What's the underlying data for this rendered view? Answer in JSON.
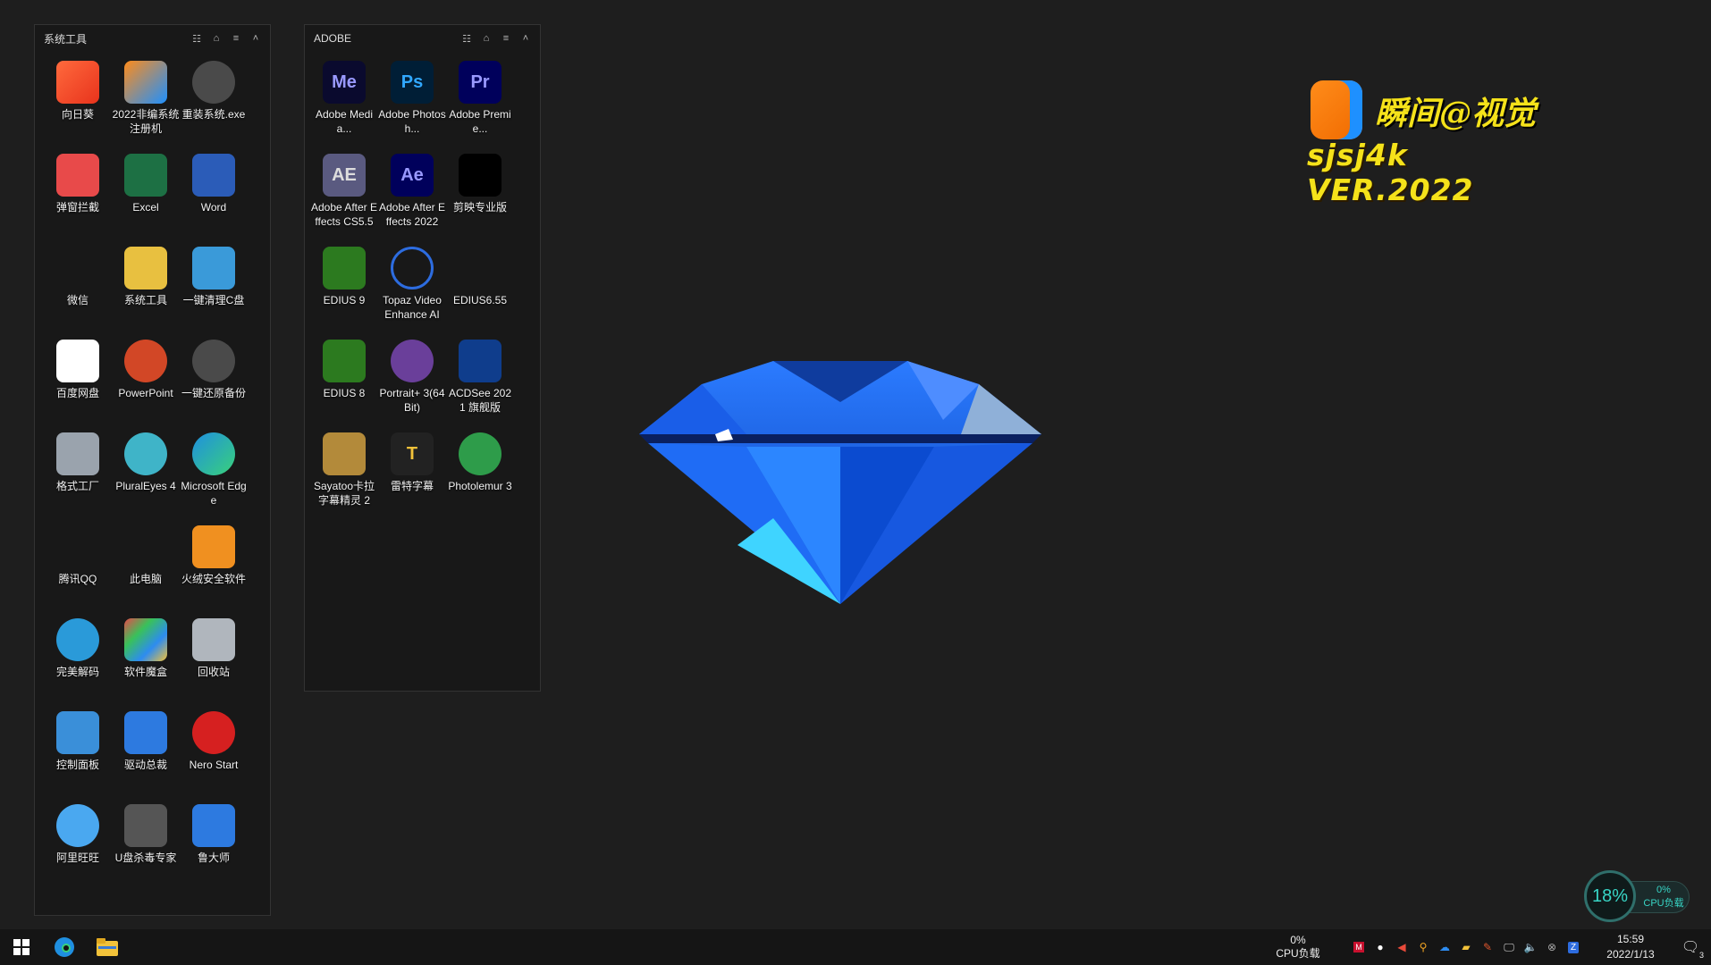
{
  "fences": {
    "system": {
      "title": "系统工具",
      "items": [
        {
          "label": "向日葵",
          "icon": "sunlogin-icon"
        },
        {
          "label": "2022非编系统注册机",
          "icon": "sjsj4k-icon"
        },
        {
          "label": "重装系统.exe",
          "icon": "reinstall-icon"
        },
        {
          "label": "弹窗拦截",
          "icon": "popup-block-icon"
        },
        {
          "label": "Excel",
          "icon": "excel-icon"
        },
        {
          "label": "Word",
          "icon": "word-icon"
        },
        {
          "label": "微信",
          "icon": "wechat-icon"
        },
        {
          "label": "系统工具",
          "icon": "system-tools-icon"
        },
        {
          "label": "一键清理C盘",
          "icon": "clean-c-icon"
        },
        {
          "label": "百度网盘",
          "icon": "baidu-pan-icon"
        },
        {
          "label": "PowerPoint",
          "icon": "powerpoint-icon"
        },
        {
          "label": "一键还原备份",
          "icon": "restore-backup-icon"
        },
        {
          "label": "格式工厂",
          "icon": "format-factory-icon"
        },
        {
          "label": "PluralEyes 4",
          "icon": "pluraleyes-icon"
        },
        {
          "label": "Microsoft Edge",
          "icon": "edge-icon"
        },
        {
          "label": "腾讯QQ",
          "icon": "qq-icon"
        },
        {
          "label": "此电脑",
          "icon": "this-pc-icon"
        },
        {
          "label": "火绒安全软件",
          "icon": "huorong-icon"
        },
        {
          "label": "完美解码",
          "icon": "potplayer-icon"
        },
        {
          "label": "软件魔盒",
          "icon": "software-box-icon"
        },
        {
          "label": "回收站",
          "icon": "recycle-bin-icon"
        },
        {
          "label": "控制面板",
          "icon": "control-panel-icon"
        },
        {
          "label": "驱动总裁",
          "icon": "driver-icon"
        },
        {
          "label": "Nero Start",
          "icon": "nero-icon"
        },
        {
          "label": "阿里旺旺",
          "icon": "aliwangwang-icon"
        },
        {
          "label": "U盘杀毒专家",
          "icon": "usb-antivirus-icon"
        },
        {
          "label": "鲁大师",
          "icon": "ludashi-icon"
        }
      ]
    },
    "adobe": {
      "title": "ADOBE",
      "items": [
        {
          "label": "Adobe Media...",
          "icon": "media-encoder-icon",
          "glyph": "Me"
        },
        {
          "label": "Adobe Photosh...",
          "icon": "photoshop-icon",
          "glyph": "Ps"
        },
        {
          "label": "Adobe Premie...",
          "icon": "premiere-icon",
          "glyph": "Pr"
        },
        {
          "label": "Adobe After Effects CS5.5",
          "icon": "after-effects-cs55-icon",
          "glyph": "AE"
        },
        {
          "label": "Adobe After Effects 2022",
          "icon": "after-effects-2022-icon",
          "glyph": "Ae"
        },
        {
          "label": "剪映专业版",
          "icon": "jianying-icon",
          "glyph": ""
        },
        {
          "label": "EDIUS 9",
          "icon": "edius9-icon",
          "glyph": ""
        },
        {
          "label": "Topaz Video Enhance AI",
          "icon": "topaz-icon",
          "glyph": ""
        },
        {
          "label": "EDIUS6.55",
          "icon": "edius655-icon",
          "glyph": ""
        },
        {
          "label": "EDIUS 8",
          "icon": "edius8-icon",
          "glyph": ""
        },
        {
          "label": "Portrait+ 3(64 Bit)",
          "icon": "portrait-plus-icon",
          "glyph": ""
        },
        {
          "label": "ACDSee 2021 旗舰版",
          "icon": "acdsee-icon",
          "glyph": ""
        },
        {
          "label": "Sayatoo卡拉字幕精灵 2",
          "icon": "sayatoo-icon",
          "glyph": ""
        },
        {
          "label": "雷特字幕",
          "icon": "leite-icon",
          "glyph": "T"
        },
        {
          "label": "Photolemur 3",
          "icon": "photolemur-icon",
          "glyph": ""
        }
      ]
    }
  },
  "logo": {
    "cn": "瞬间@视觉",
    "en": "sjsj4k VER.2022"
  },
  "cpu_widget": {
    "percent": "18%",
    "load": "0%",
    "label": "CPU负载"
  },
  "taskbar": {
    "cpu_percent": "0%",
    "cpu_label": "CPU负载",
    "time": "15:59",
    "date": "2022/1/13",
    "notifications": "3"
  }
}
